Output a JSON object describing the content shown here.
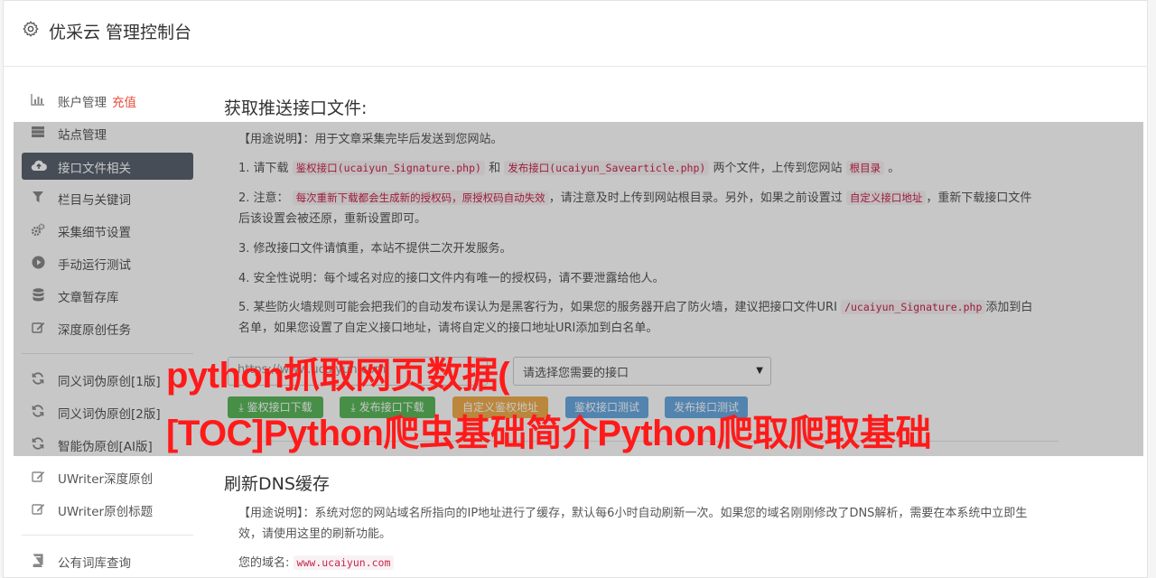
{
  "header": {
    "title": "优采云 管理控制台",
    "icon": "gear-icon"
  },
  "sidebar": {
    "items": [
      {
        "label": "账户管理",
        "extra": "充值",
        "icon": "bar-chart-icon"
      },
      {
        "label": "站点管理",
        "icon": "server-icon"
      },
      {
        "label": "接口文件相关",
        "icon": "cloud-upload-icon"
      },
      {
        "label": "栏目与关键词",
        "icon": "filter-icon"
      },
      {
        "label": "采集细节设置",
        "icon": "cogs-icon"
      },
      {
        "label": "手动运行测试",
        "icon": "play-circle-icon"
      },
      {
        "label": "文章暂存库",
        "icon": "database-icon"
      },
      {
        "label": "深度原创任务",
        "icon": "edit-icon"
      },
      {
        "label": "同义词伪原创[1版]",
        "icon": "refresh-icon"
      },
      {
        "label": "同义词伪原创[2版]",
        "icon": "refresh-icon"
      },
      {
        "label": "智能伪原创[AI版]",
        "icon": "refresh-icon"
      },
      {
        "label": "UWriter深度原创",
        "icon": "edit-icon"
      },
      {
        "label": "UWriter原创标题",
        "icon": "edit-icon"
      },
      {
        "label": "公有词库查询",
        "icon": "book-icon"
      }
    ]
  },
  "section1": {
    "title": "获取推送接口文件:",
    "usage": "【用途说明】：用于文章采集完毕后发送到您网站。",
    "line1_a": "1. 请下载",
    "line1_code1": "鉴权接口(ucaiyun_Signature.php)",
    "line1_b": "和",
    "line1_code2": "发布接口(ucaiyun_Savearticle.php)",
    "line1_c": "两个文件，上传到您网站",
    "line1_code3": "根目录",
    "line1_d": "。",
    "line2_a": "2. 注意：",
    "line2_code1": "每次重新下载都会生成新的授权码，原授权码自动失效",
    "line2_b": "，请注意及时上传到网站根目录。另外，如果之前设置过",
    "line2_code2": "自定义接口地址",
    "line2_c": "，重新下载接口文件后该设置会被还原，重新设置即可。",
    "line3": "3. 修改接口文件请慎重，本站不提供二次开发服务。",
    "line4": "4. 安全性说明：每个域名对应的接口文件内有唯一的授权码，请不要泄露给他人。",
    "line5_a": "5. 某些防火墙规则可能会把我们的自动发布误认为是黑客行为，如果您的服务器开启了防火墙，建议把接口文件URI",
    "line5_code": "/ucaiyun_Signature.php",
    "line5_b": "添加到白名单，如果您设置了自定义接口地址，请将自定义的接口地址URI添加到白名单。",
    "url_placeholder": "https://www.ucaiyun.com",
    "select_value": "请选择您需要的接口",
    "btn_sig_download": "鉴权接口下载",
    "btn_save_download": "发布接口下载",
    "btn_custom": "自定义鉴权地址",
    "btn_sig_test": "鉴权接口测试",
    "btn_save_test": "发布接口测试"
  },
  "section2": {
    "title": "刷新DNS缓存",
    "usage": "【用途说明】：系统对您的网站域名所指向的IP地址进行了缓存，默认每6小时自动刷新一次。如果您的域名刚刚修改了DNS解析，需要在本系统中立即生效，请使用这里的刷新功能。",
    "domain_label": "您的域名:",
    "domain_value": "www.ucaiyun.com"
  },
  "overlay": {
    "headline_line1": "python抓取网页数据(",
    "headline_line2": "[TOC]Python爬虫基础简介Python爬取爬取基础"
  },
  "colors": {
    "active_nav": "#5a6370",
    "recharge": "#e74c3c",
    "code": "#c7254e",
    "headline": "#ff1a1a"
  }
}
